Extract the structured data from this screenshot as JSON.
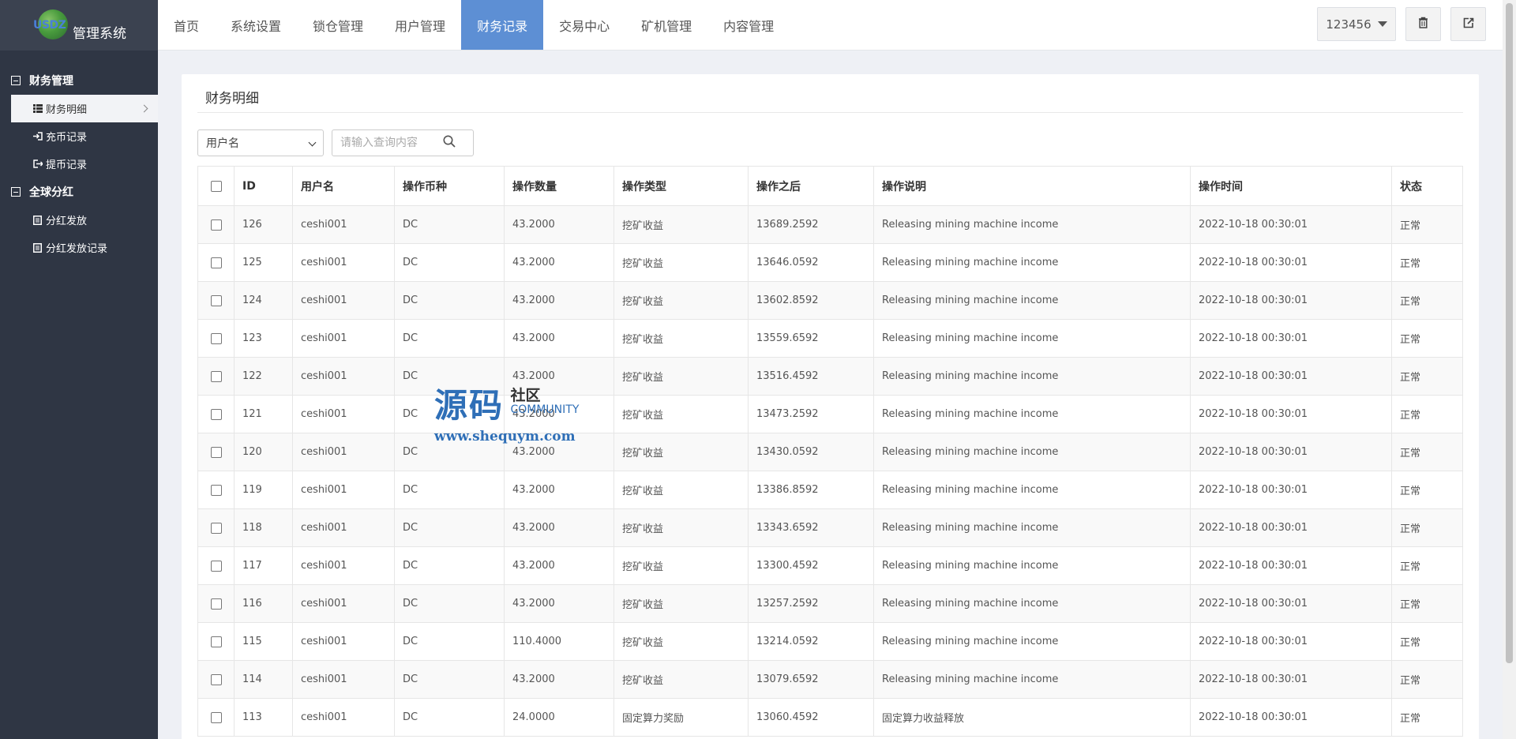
{
  "app": {
    "logo_letters": "USDZ",
    "title": "管理系统"
  },
  "topnav": {
    "tabs": [
      {
        "label": "首页",
        "active": false
      },
      {
        "label": "系统设置",
        "active": false
      },
      {
        "label": "锁仓管理",
        "active": false
      },
      {
        "label": "用户管理",
        "active": false
      },
      {
        "label": "财务记录",
        "active": true
      },
      {
        "label": "交易中心",
        "active": false
      },
      {
        "label": "矿机管理",
        "active": false
      },
      {
        "label": "内容管理",
        "active": false
      }
    ],
    "user": "123456"
  },
  "sidebar": {
    "groups": [
      {
        "label": "财务管理",
        "items": [
          {
            "label": "财务明细",
            "active": true,
            "icon": "list-icon"
          },
          {
            "label": "充币记录",
            "active": false,
            "icon": "sign-in-icon"
          },
          {
            "label": "提币记录",
            "active": false,
            "icon": "sign-out-icon"
          }
        ]
      },
      {
        "label": "全球分红",
        "items": [
          {
            "label": "分红发放",
            "active": false,
            "icon": "document-icon"
          },
          {
            "label": "分红发放记录",
            "active": false,
            "icon": "document-icon"
          }
        ]
      }
    ]
  },
  "panel": {
    "title": "财务明细",
    "filter": {
      "select_value": "用户名",
      "search_placeholder": "请输入查询内容"
    },
    "columns": [
      "ID",
      "用户名",
      "操作币种",
      "操作数量",
      "操作类型",
      "操作之后",
      "操作说明",
      "操作时间",
      "状态"
    ],
    "rows": [
      [
        "126",
        "ceshi001",
        "DC",
        "43.2000",
        "挖矿收益",
        "13689.2592",
        "Releasing mining machine income",
        "2022-10-18 00:30:01",
        "正常"
      ],
      [
        "125",
        "ceshi001",
        "DC",
        "43.2000",
        "挖矿收益",
        "13646.0592",
        "Releasing mining machine income",
        "2022-10-18 00:30:01",
        "正常"
      ],
      [
        "124",
        "ceshi001",
        "DC",
        "43.2000",
        "挖矿收益",
        "13602.8592",
        "Releasing mining machine income",
        "2022-10-18 00:30:01",
        "正常"
      ],
      [
        "123",
        "ceshi001",
        "DC",
        "43.2000",
        "挖矿收益",
        "13559.6592",
        "Releasing mining machine income",
        "2022-10-18 00:30:01",
        "正常"
      ],
      [
        "122",
        "ceshi001",
        "DC",
        "43.2000",
        "挖矿收益",
        "13516.4592",
        "Releasing mining machine income",
        "2022-10-18 00:30:01",
        "正常"
      ],
      [
        "121",
        "ceshi001",
        "DC",
        "43.2000",
        "挖矿收益",
        "13473.2592",
        "Releasing mining machine income",
        "2022-10-18 00:30:01",
        "正常"
      ],
      [
        "120",
        "ceshi001",
        "DC",
        "43.2000",
        "挖矿收益",
        "13430.0592",
        "Releasing mining machine income",
        "2022-10-18 00:30:01",
        "正常"
      ],
      [
        "119",
        "ceshi001",
        "DC",
        "43.2000",
        "挖矿收益",
        "13386.8592",
        "Releasing mining machine income",
        "2022-10-18 00:30:01",
        "正常"
      ],
      [
        "118",
        "ceshi001",
        "DC",
        "43.2000",
        "挖矿收益",
        "13343.6592",
        "Releasing mining machine income",
        "2022-10-18 00:30:01",
        "正常"
      ],
      [
        "117",
        "ceshi001",
        "DC",
        "43.2000",
        "挖矿收益",
        "13300.4592",
        "Releasing mining machine income",
        "2022-10-18 00:30:01",
        "正常"
      ],
      [
        "116",
        "ceshi001",
        "DC",
        "43.2000",
        "挖矿收益",
        "13257.2592",
        "Releasing mining machine income",
        "2022-10-18 00:30:01",
        "正常"
      ],
      [
        "115",
        "ceshi001",
        "DC",
        "110.4000",
        "挖矿收益",
        "13214.0592",
        "Releasing mining machine income",
        "2022-10-18 00:30:01",
        "正常"
      ],
      [
        "114",
        "ceshi001",
        "DC",
        "43.2000",
        "挖矿收益",
        "13079.6592",
        "Releasing mining machine income",
        "2022-10-18 00:30:01",
        "正常"
      ],
      [
        "113",
        "ceshi001",
        "DC",
        "24.0000",
        "固定算力奖励",
        "13060.4592",
        "固定算力收益释放",
        "2022-10-18 00:30:01",
        "正常"
      ]
    ]
  },
  "watermark": {
    "big": "源码",
    "cn": "社区",
    "en": "COMMUNITY",
    "url": "www.shequym.com"
  },
  "colors": {
    "sidebar": "#2f3644",
    "accent": "#5d8fd4"
  }
}
